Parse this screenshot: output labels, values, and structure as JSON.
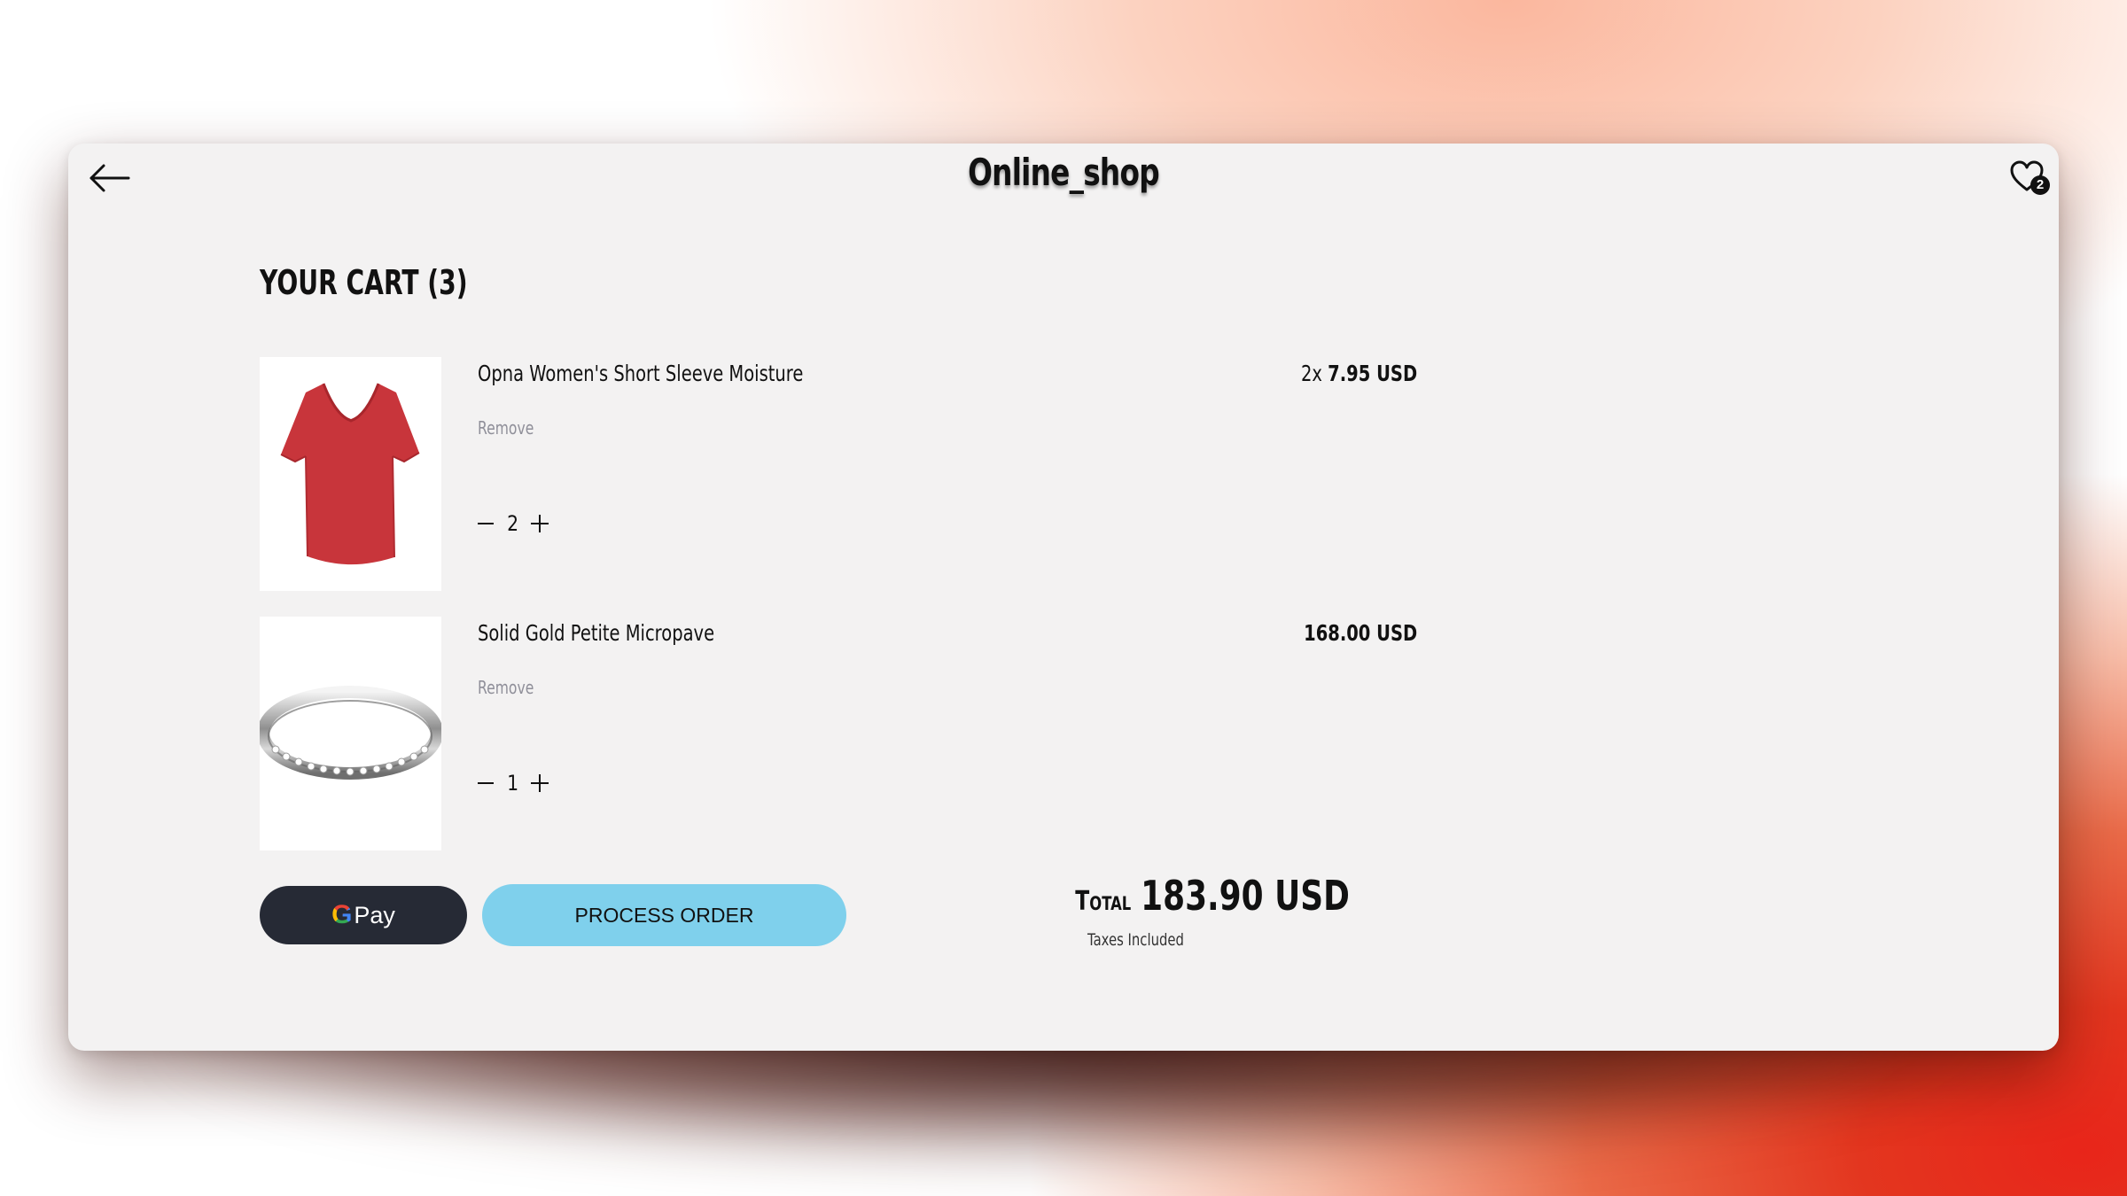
{
  "header": {
    "title": "Online_shop",
    "wishlist_count": "2"
  },
  "cart": {
    "heading": "YOUR CART (3)",
    "items": [
      {
        "name": "Opna Women's Short Sleeve Moisture",
        "remove_label": "Remove",
        "quantity": "2",
        "multiplier": "2x",
        "price": "7.95 USD",
        "image": "red-tshirt"
      },
      {
        "name": "Solid Gold Petite Micropave",
        "remove_label": "Remove",
        "quantity": "1",
        "multiplier": "",
        "price": "168.00 USD",
        "image": "silver-ring"
      }
    ]
  },
  "actions": {
    "gpay_g": "G",
    "gpay_label": "Pay",
    "process_label": "PROCESS ORDER"
  },
  "summary": {
    "total_label": "Total",
    "total_amount": "183.90 USD",
    "tax_note": "Taxes Included"
  },
  "icons": {
    "back": "arrow-left-icon",
    "wishlist": "heart-icon",
    "decrease": "minus-icon",
    "increase": "plus-icon"
  },
  "colors": {
    "card_bg": "#f3f2f2",
    "process_button": "#7fd0ec",
    "gpay_button": "#262a35",
    "tshirt": "#c8353b"
  }
}
